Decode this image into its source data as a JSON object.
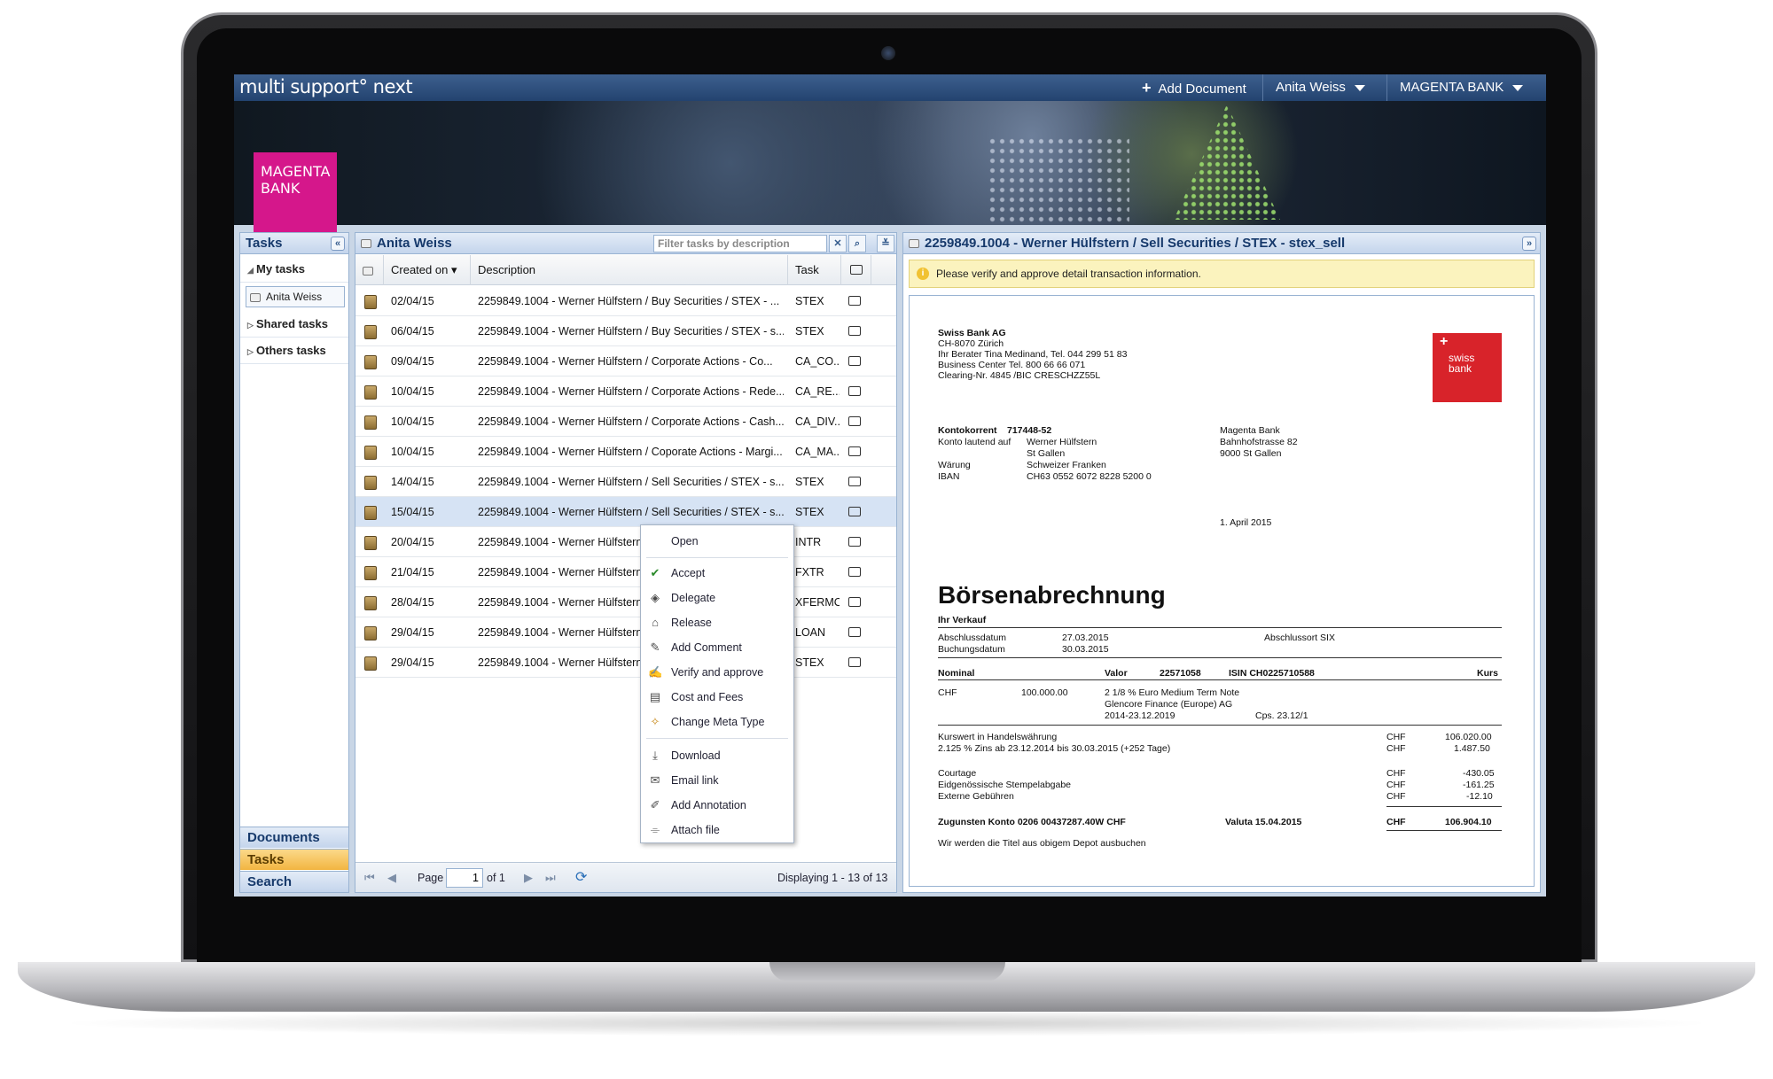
{
  "app": {
    "logo": "multi support° next",
    "add_document": "Add Document",
    "user_menu": "Anita Weiss",
    "bank_menu": "MAGENTA BANK",
    "brand_line1": "MAGENTA",
    "brand_line2": "BANK"
  },
  "nav": {
    "title": "Tasks",
    "my_tasks": "My tasks",
    "my_tasks_user": "Anita Weiss",
    "shared_tasks": "Shared tasks",
    "others_tasks": "Others tasks",
    "bottom_tabs": [
      "Documents",
      "Tasks",
      "Search"
    ]
  },
  "tasks": {
    "title": "Anita Weiss",
    "filter_placeholder": "Filter tasks by description",
    "columns": {
      "created": "Created on",
      "description": "Description",
      "task": "Task"
    },
    "rows": [
      {
        "date": "02/04/15",
        "desc": "2259849.1004 - Werner Hülfstern / Buy Securities / STEX - ...",
        "task": "STEX"
      },
      {
        "date": "06/04/15",
        "desc": "2259849.1004 - Werner Hülfstern / Buy Securities / STEX - s...",
        "task": "STEX"
      },
      {
        "date": "09/04/15",
        "desc": "2259849.1004 - Werner Hülfstern / Corporate Actions - Co...",
        "task": "CA_CO..."
      },
      {
        "date": "10/04/15",
        "desc": "2259849.1004 - Werner Hülfstern / Corporate Actions - Rede...",
        "task": "CA_RE..."
      },
      {
        "date": "10/04/15",
        "desc": "2259849.1004 - Werner Hülfstern / Corporate Actions - Cash...",
        "task": "CA_DIV..."
      },
      {
        "date": "10/04/15",
        "desc": "2259849.1004 - Werner Hülfstern / Coporate Actions - Margi...",
        "task": "CA_MA..."
      },
      {
        "date": "14/04/15",
        "desc": "2259849.1004 - Werner Hülfstern / Sell Securities / STEX - s...",
        "task": "STEX"
      },
      {
        "date": "15/04/15",
        "desc": "2259849.1004 - Werner Hülfstern / Sell Securities / STEX - s...",
        "task": "STEX"
      },
      {
        "date": "20/04/15",
        "desc": "2259849.1004 - Werner Hülfstern",
        "task": "INTR"
      },
      {
        "date": "21/04/15",
        "desc": "2259849.1004 - Werner Hülfstern",
        "task": "FXTR"
      },
      {
        "date": "28/04/15",
        "desc": "2259849.1004 - Werner Hülfstern",
        "task": "XFERMC"
      },
      {
        "date": "29/04/15",
        "desc": "2259849.1004 - Werner Hülfstern",
        "task": "LOAN"
      },
      {
        "date": "29/04/15",
        "desc": "2259849.1004 - Werner Hülfstern",
        "task": "STEX"
      }
    ],
    "pager": {
      "page_label": "Page",
      "page_value": "1",
      "of_label": "of 1",
      "displaying": "Displaying 1 - 13 of 13"
    }
  },
  "context_menu": {
    "open": "Open",
    "accept": "Accept",
    "delegate": "Delegate",
    "release": "Release",
    "add_comment": "Add Comment",
    "verify": "Verify and approve",
    "cost": "Cost and Fees",
    "meta": "Change Meta Type",
    "download": "Download",
    "email": "Email link",
    "annotation": "Add Annotation",
    "attach": "Attach file"
  },
  "detail": {
    "title": "2259849.1004 - Werner Hülfstern / Sell Securities / STEX - stex_sell",
    "notice": "Please verify and approve detail transaction information.",
    "doc": {
      "sender_name": "Swiss Bank AG",
      "sender_city": "CH-8070 Zürich",
      "sender_advisor": "Ihr Berater Tina Medinand, Tel. 044 299 51 83",
      "sender_center": "Business Center Tel. 800 66 66 071",
      "sender_clearing": "Clearing-Nr. 4845 /BIC CRESCHZZ55L",
      "logo_line1": "swiss",
      "logo_line2": "bank",
      "konto_label": "Kontokorrent",
      "konto_nr": "717448-52",
      "lautend_label": "Konto lautend auf",
      "lautend_name": "Werner Hülfstern",
      "lautend_city": "St Gallen",
      "waehrung_label": "Wärung",
      "waehrung_value": "Schweizer Franken",
      "iban_label": "IBAN",
      "iban_value": "CH63 0552 6072 8228 5200 0",
      "recipient_name": "Magenta Bank",
      "recipient_street": "Bahnhofstrasse 82",
      "recipient_city": "9000 St Gallen",
      "date": "1. April 2015",
      "heading": "Börsenabrechnung",
      "subheading": "Ihr Verkauf",
      "abschluss_label": "Abschlussdatum",
      "abschluss_value": "27.03.2015",
      "abschlussort": "Abschlussort SIX",
      "buchung_label": "Buchungsdatum",
      "buchung_value": "30.03.2015",
      "col_nominal": "Nominal",
      "col_valor": "Valor",
      "valor_value": "22571058",
      "isin": "ISIN CH0225710588",
      "col_kurs": "Kurs",
      "ccy": "CHF",
      "nominal_value": "100.000.00",
      "sec_line1": "2 1/8 % Euro Medium Term Note",
      "sec_line2": "Glencore Finance (Europe) AG",
      "sec_line3": "2014-23.12.2019",
      "cps": "Cps. 23.12/1",
      "kurswert_label": "Kurswert in Handelswährung",
      "kurswert_value": "106.020.00",
      "zins_label": "2.125 % Zins ab 23.12.2014 bis 30.03.2015 (+252 Tage)",
      "zins_value": "1.487.50",
      "courtage_label": "Courtage",
      "courtage_value": "-430.05",
      "stempel_label": "Eidgenössische Stempelabgabe",
      "stempel_value": "-161.25",
      "externe_label": "Externe Gebühren",
      "externe_value": "-12.10",
      "zugunsten_label": "Zugunsten Konto 0206 00437287.40W CHF",
      "valuta_label": "Valuta 15.04.2015",
      "total_value": "106.904.10",
      "footer": "Wir werden die Titel aus obigem Depot ausbuchen"
    }
  }
}
